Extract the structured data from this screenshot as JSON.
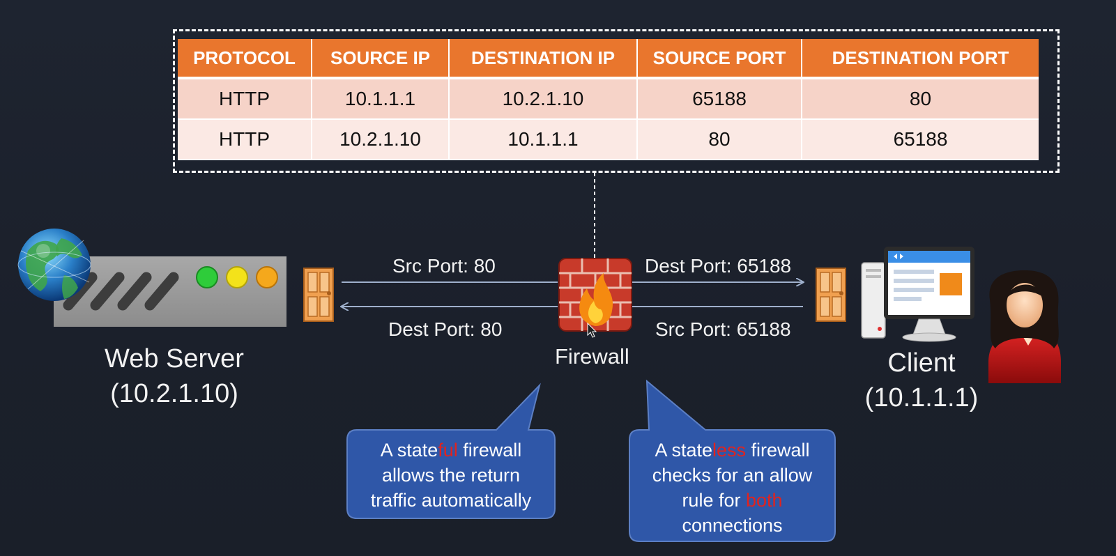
{
  "table": {
    "headers": [
      "PROTOCOL",
      "SOURCE IP",
      "DESTINATION IP",
      "SOURCE PORT",
      "DESTINATION PORT"
    ],
    "rows": [
      [
        "HTTP",
        "10.1.1.1",
        "10.2.1.10",
        "65188",
        "80"
      ],
      [
        "HTTP",
        "10.2.1.10",
        "10.1.1.1",
        "80",
        "65188"
      ]
    ]
  },
  "web_server": {
    "name": "Web Server",
    "ip": "(10.2.1.10)"
  },
  "client": {
    "name": "Client",
    "ip": "(10.1.1.1)"
  },
  "firewall": {
    "name": "Firewall"
  },
  "flows": {
    "left_top": "Src Port: 80",
    "left_bottom": "Dest Port: 80",
    "right_top": "Dest Port: 65188",
    "right_bottom": "Src Port: 65188"
  },
  "callouts": {
    "stateful": {
      "pre": "A state",
      "highlight": "ful",
      "post": " firewall",
      "line2": "allows the return",
      "line3": "traffic automatically"
    },
    "stateless": {
      "pre": "A state",
      "highlight": "less",
      "post": " firewall",
      "line2": "checks for an allow",
      "line3_pre": "rule for ",
      "line3_highlight": "both",
      "line4": "connections"
    }
  },
  "colors": {
    "background": "#1c212c",
    "table_header": "#e9762d",
    "row_odd": "#f6d3c8",
    "row_even": "#fbe9e4",
    "callout_fill": "#2f57a8",
    "highlight_red": "#e0231f",
    "arrow": "#9fb0cc",
    "server_led_green": "#2ecc3a",
    "server_led_yellow": "#f3e21a",
    "server_led_orange": "#f5a81c",
    "door": "#f0a050"
  },
  "icons": [
    "globe-icon",
    "server-icon",
    "door-icon",
    "firewall-brick-icon",
    "flame-icon",
    "computer-icon",
    "user-avatar-icon",
    "mouse-cursor-icon"
  ]
}
